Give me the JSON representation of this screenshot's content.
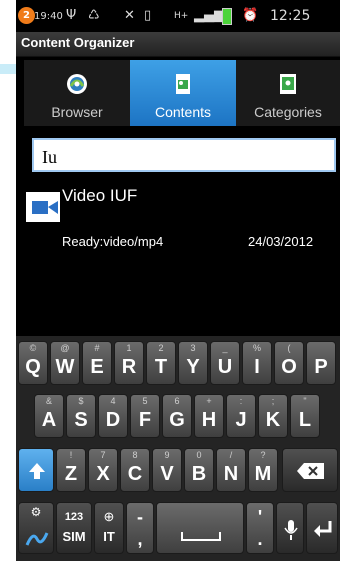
{
  "status": {
    "notif_count": "2",
    "time_small": "19:40",
    "time": "12:25"
  },
  "app": {
    "title": "Content Organizer"
  },
  "tabs": [
    {
      "label": "Browser",
      "icon": "globe-icon",
      "active": false
    },
    {
      "label": "Contents",
      "icon": "document-icon",
      "active": true
    },
    {
      "label": "Categories",
      "icon": "category-icon",
      "active": false
    }
  ],
  "search": {
    "value": "Iu"
  },
  "items": [
    {
      "title": "Video IUF",
      "subtitle": "Ready:video/mp4",
      "date": "24/03/2012",
      "icon": "video-camera-icon"
    }
  ],
  "keyboard": {
    "row1": [
      {
        "key": "Q",
        "hint": "©"
      },
      {
        "key": "W",
        "hint": "@"
      },
      {
        "key": "E",
        "hint": "#"
      },
      {
        "key": "R",
        "hint": "1"
      },
      {
        "key": "T",
        "hint": "2"
      },
      {
        "key": "Y",
        "hint": "3"
      },
      {
        "key": "U",
        "hint": "_"
      },
      {
        "key": "I",
        "hint": "%"
      },
      {
        "key": "O",
        "hint": "("
      },
      {
        "key": "P",
        "hint": ""
      }
    ],
    "row2": [
      {
        "key": "A",
        "hint": "&"
      },
      {
        "key": "S",
        "hint": "$"
      },
      {
        "key": "D",
        "hint": "4"
      },
      {
        "key": "F",
        "hint": "5"
      },
      {
        "key": "G",
        "hint": "6"
      },
      {
        "key": "H",
        "hint": "+"
      },
      {
        "key": "J",
        "hint": ":"
      },
      {
        "key": "K",
        "hint": ";"
      },
      {
        "key": "L",
        "hint": "\""
      }
    ],
    "row3": [
      {
        "key": "Z",
        "hint": "!"
      },
      {
        "key": "X",
        "hint": "7"
      },
      {
        "key": "C",
        "hint": "8"
      },
      {
        "key": "V",
        "hint": "9"
      },
      {
        "key": "B",
        "hint": "0"
      },
      {
        "key": "N",
        "hint": "/"
      },
      {
        "key": "M",
        "hint": "?"
      }
    ],
    "sym_label": "123",
    "sym_label2": "SIM",
    "lang_label": "IT",
    "comma": ",",
    "period": ".",
    "hyphen": "-",
    "apostrophe": "'"
  },
  "colors": {
    "accent": "#2a8ad8",
    "notif": "#f07c1a"
  }
}
